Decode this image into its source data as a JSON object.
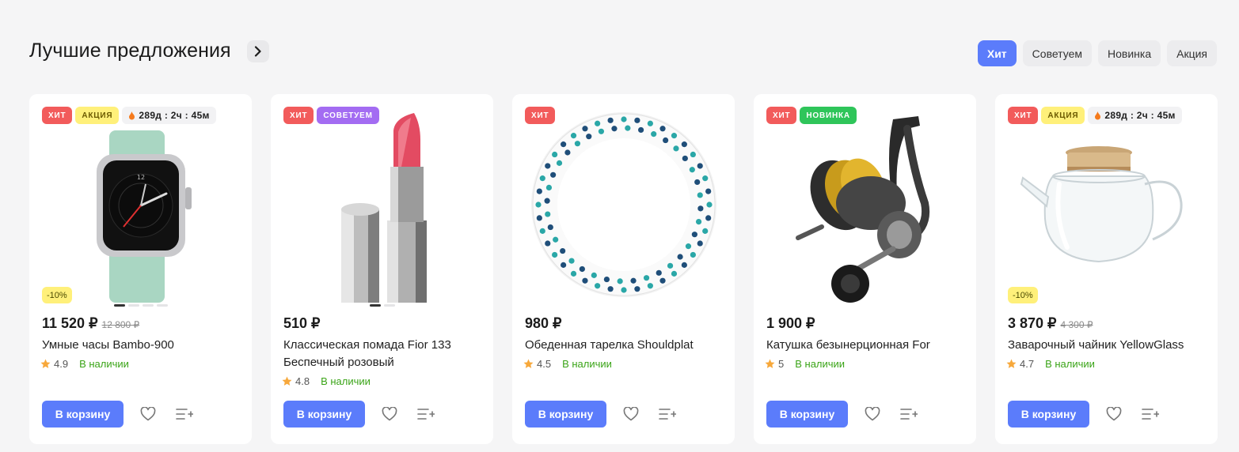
{
  "section": {
    "title": "Лучшие предложения"
  },
  "filters": [
    {
      "label": "Хит",
      "active": true
    },
    {
      "label": "Советуем",
      "active": false
    },
    {
      "label": "Новинка",
      "active": false
    },
    {
      "label": "Акция",
      "active": false
    }
  ],
  "products": [
    {
      "badges": [
        "Хит",
        "Акция"
      ],
      "timer": "289д : 2ч : 45м",
      "discount": "-10%",
      "price": "11 520 ₽",
      "old_price": "12 800 ₽",
      "title": "Умные часы Bambo-900",
      "rating": "4.9",
      "stock": "В наличии",
      "cart_label": "В корзину"
    },
    {
      "badges": [
        "Хит",
        "Советуем"
      ],
      "timer": "",
      "discount": "",
      "price": "510 ₽",
      "old_price": "",
      "title": "Классическая помада Fior 133 Беспечный розовый",
      "rating": "4.8",
      "stock": "В наличии",
      "cart_label": "В корзину"
    },
    {
      "badges": [
        "Хит"
      ],
      "timer": "",
      "discount": "",
      "price": "980 ₽",
      "old_price": "",
      "title": "Обеденная тарелка Shouldplat",
      "rating": "4.5",
      "stock": "В наличии",
      "cart_label": "В корзину"
    },
    {
      "badges": [
        "Хит",
        "Новинка"
      ],
      "timer": "",
      "discount": "",
      "price": "1 900 ₽",
      "old_price": "",
      "title": "Катушка безынерционная For",
      "rating": "5",
      "stock": "В наличии",
      "cart_label": "В корзину"
    },
    {
      "badges": [
        "Хит",
        "Акция"
      ],
      "timer": "289д : 2ч : 45м",
      "discount": "-10%",
      "price": "3 870 ₽",
      "old_price": "4 300 ₽",
      "title": "Заварочный чайник YellowGlass",
      "rating": "4.7",
      "stock": "В наличии",
      "cart_label": "В корзину"
    }
  ],
  "colors": {
    "accent": "#5b7cfb",
    "hit": "#f25b5b",
    "promo": "#fff07a",
    "advise": "#a36cf2",
    "new": "#2fc55a",
    "stock": "#3aa417"
  },
  "icons": [
    "chevron-right-icon",
    "fire-icon",
    "star-icon",
    "heart-icon",
    "compare-list-icon"
  ]
}
